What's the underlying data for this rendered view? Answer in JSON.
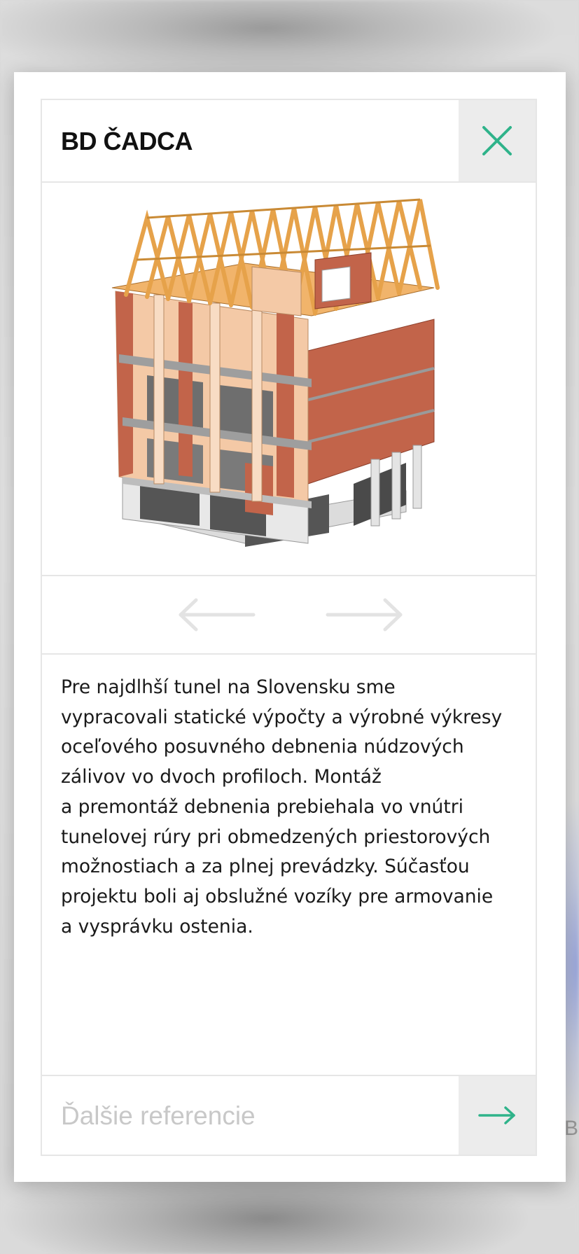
{
  "modal": {
    "title": "BD ČADCA",
    "close_icon": "close-icon",
    "accent_color": "#2fb38a",
    "image_alt": "3D model of a residential building structure with timber roof trusses",
    "gallery": {
      "prev_icon": "arrow-left-icon",
      "next_icon": "arrow-right-icon"
    },
    "description": "Pre najdlhší tunel na Slovensku sme\nvypracovali statické výpočty a výrobné výkresy\noceľového posuvného debnenia núdzových\nzálivov vo dvoch profiloch. Montáž\na premontáž debnenia prebiehala vo vnútri\ntunelovej rúry pri obmedzených priestorových\nmožnostiach a za plnej prevádzky. Súčasťou\nprojektu boli aj obslužné vozíky pre armovanie\na vysprávku ostenia.",
    "footer": {
      "more_label": "Ďalšie referencie",
      "next_icon": "arrow-right-icon"
    }
  },
  "background": {
    "edge_text": "EB"
  }
}
